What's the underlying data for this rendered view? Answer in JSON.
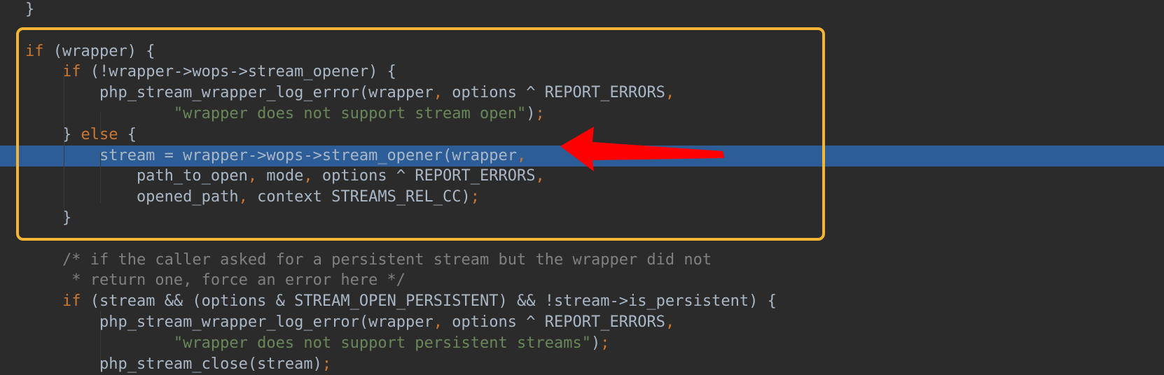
{
  "editor": {
    "lines": [
      {
        "tokens": [
          {
            "t": "}",
            "c": "plain"
          }
        ]
      },
      {
        "tokens": []
      },
      {
        "tokens": [
          {
            "t": "if",
            "c": "kw"
          },
          {
            "t": " (wrapper) {",
            "c": "plain"
          }
        ]
      },
      {
        "tokens": [
          {
            "t": "    if",
            "c": "kw"
          },
          {
            "t": " (!wrapper->wops->stream_opener) {",
            "c": "plain"
          }
        ]
      },
      {
        "tokens": [
          {
            "t": "        php_stream_wrapper_log_error(wrapper",
            "c": "plain"
          },
          {
            "t": ",",
            "c": "punct"
          },
          {
            "t": " options ^ REPORT_ERRORS",
            "c": "plain"
          },
          {
            "t": ",",
            "c": "punct"
          }
        ]
      },
      {
        "tokens": [
          {
            "t": "                ",
            "c": "plain"
          },
          {
            "t": "\"wrapper does not support stream open\"",
            "c": "str"
          },
          {
            "t": ")",
            "c": "plain"
          },
          {
            "t": ";",
            "c": "punct"
          }
        ]
      },
      {
        "tokens": [
          {
            "t": "    } ",
            "c": "plain"
          },
          {
            "t": "else",
            "c": "kw"
          },
          {
            "t": " {",
            "c": "plain"
          }
        ]
      },
      {
        "tokens": [
          {
            "t": "        stream = wrapper->wops->stream_opener(wrapper",
            "c": "plain"
          },
          {
            "t": ",",
            "c": "punct"
          }
        ],
        "current": true
      },
      {
        "tokens": [
          {
            "t": "            path_to_open",
            "c": "plain"
          },
          {
            "t": ",",
            "c": "punct"
          },
          {
            "t": " mode",
            "c": "plain"
          },
          {
            "t": ",",
            "c": "punct"
          },
          {
            "t": " options ^ REPORT_ERRORS",
            "c": "plain"
          },
          {
            "t": ",",
            "c": "punct"
          }
        ]
      },
      {
        "tokens": [
          {
            "t": "            opened_path",
            "c": "plain"
          },
          {
            "t": ",",
            "c": "punct"
          },
          {
            "t": " context STREAMS_REL_CC)",
            "c": "plain"
          },
          {
            "t": ";",
            "c": "punct"
          }
        ]
      },
      {
        "tokens": [
          {
            "t": "    }",
            "c": "plain"
          }
        ]
      },
      {
        "tokens": []
      },
      {
        "tokens": [
          {
            "t": "    /* if the caller asked for a persistent stream but the wrapper did not",
            "c": "comment"
          }
        ]
      },
      {
        "tokens": [
          {
            "t": "     * return one, force an error here */",
            "c": "comment"
          }
        ]
      },
      {
        "tokens": [
          {
            "t": "    if",
            "c": "kw"
          },
          {
            "t": " (stream && (options & STREAM_OPEN_PERSISTENT) && !stream->is_persistent) {",
            "c": "plain"
          }
        ]
      },
      {
        "tokens": [
          {
            "t": "        php_stream_wrapper_log_error(wrapper",
            "c": "plain"
          },
          {
            "t": ",",
            "c": "punct"
          },
          {
            "t": " options ^ REPORT_ERRORS",
            "c": "plain"
          },
          {
            "t": ",",
            "c": "punct"
          }
        ]
      },
      {
        "tokens": [
          {
            "t": "                ",
            "c": "plain"
          },
          {
            "t": "\"wrapper does not support persistent streams\"",
            "c": "str"
          },
          {
            "t": ")",
            "c": "plain"
          },
          {
            "t": ";",
            "c": "punct"
          }
        ]
      },
      {
        "tokens": [
          {
            "t": "        php_stream_close(stream)",
            "c": "plain"
          },
          {
            "t": ";",
            "c": "punct"
          }
        ]
      }
    ]
  },
  "colors": {
    "background": "#2b2b2b",
    "current_line": "#2d5d97",
    "keyword": "#cc7832",
    "string": "#6a8759",
    "comment": "#808080",
    "text": "#a9b7c6",
    "annotation_box": "#f4b536",
    "annotation_arrow": "#ff0000"
  }
}
